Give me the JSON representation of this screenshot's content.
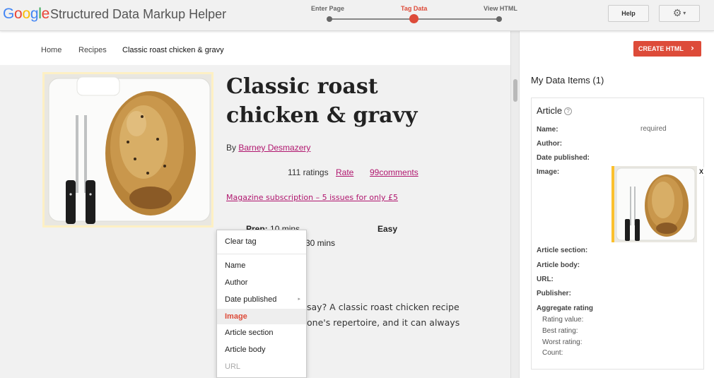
{
  "header": {
    "logo": [
      "G",
      "o",
      "o",
      "g",
      "l",
      "e"
    ],
    "title": "Structured Data Markup Helper",
    "steps": [
      {
        "label": "Enter Page",
        "active": false
      },
      {
        "label": "Tag Data",
        "active": true
      },
      {
        "label": "View HTML",
        "active": false
      }
    ],
    "help_label": "Help",
    "gear_icon": "gear-icon",
    "gear_caret": "▾"
  },
  "breadcrumb": [
    "Home",
    "Recipes",
    "Classic roast chicken & gravy"
  ],
  "recipe": {
    "title": "Classic roast chicken & gravy",
    "by_prefix": "By ",
    "author": "Barney Desmazery",
    "ratings": "111 ratings",
    "rate_link": "Rate",
    "comments_link": "99comments",
    "magazine_link": "Magazine subscription – 5 issues for only £5",
    "prep_label": "Prep:",
    "prep_value": "10 mins",
    "cook_value": "30 mins",
    "difficulty": "Easy",
    "description_lines": [
      "say? A classic roast chicken recipe",
      "one's repertoire, and it can always"
    ]
  },
  "context_menu": {
    "clear_tag": "Clear tag",
    "items": [
      {
        "label": "Name",
        "state": "normal"
      },
      {
        "label": "Author",
        "state": "normal"
      },
      {
        "label": "Date published",
        "state": "normal",
        "submenu": "▸"
      },
      {
        "label": "Image",
        "state": "active"
      },
      {
        "label": "Article section",
        "state": "normal"
      },
      {
        "label": "Article body",
        "state": "normal"
      },
      {
        "label": "URL",
        "state": "disabled"
      }
    ]
  },
  "panel": {
    "create_label": "CREATE HTML",
    "create_chevron": "›",
    "title": "My Data Items (1)",
    "item_type": "Article",
    "help_icon": "?",
    "required_text": "required",
    "image_close": "X",
    "fields": [
      "Name:",
      "Author:",
      "Date published:",
      "Image:",
      "Article section:",
      "Article body:",
      "URL:",
      "Publisher:",
      "Aggregate rating"
    ],
    "rating_fields": [
      "Rating value:",
      "Best rating:",
      "Worst rating:",
      "Count:"
    ]
  },
  "colors": {
    "accent": "#dd4b39",
    "link": "#b0166e",
    "image_highlight": "#fbc02d"
  }
}
